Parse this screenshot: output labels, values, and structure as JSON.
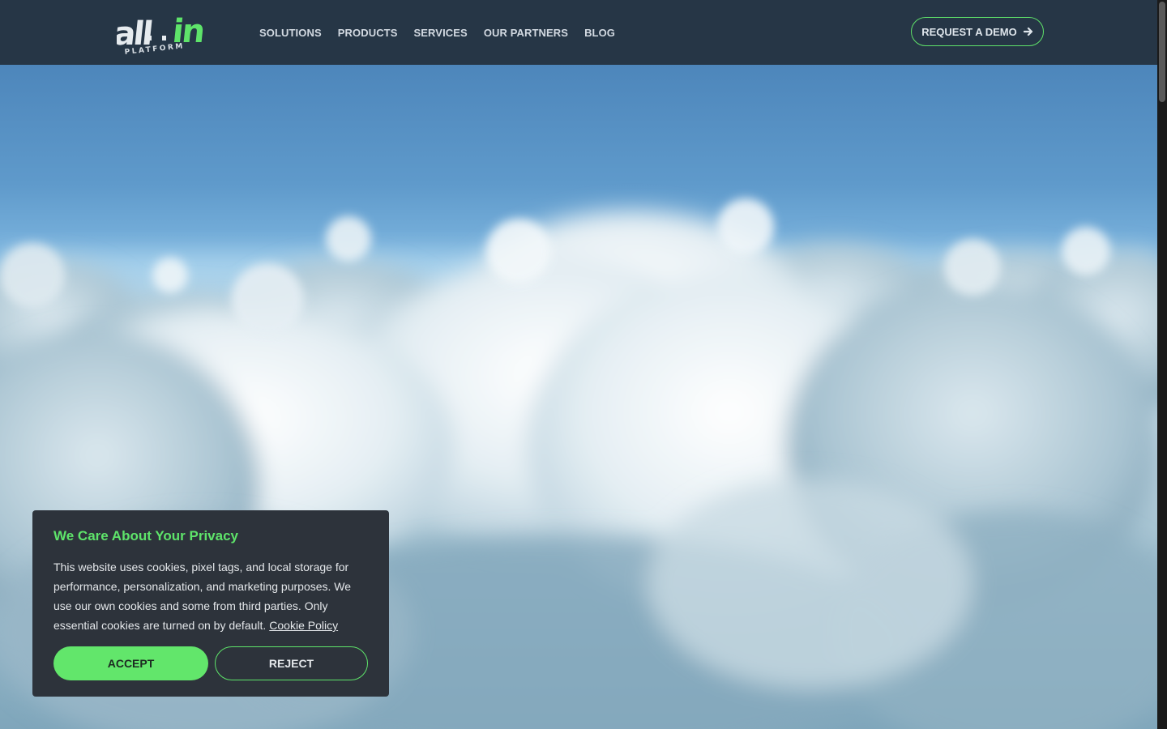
{
  "brand": {
    "logo_text_main": "all",
    "logo_text_accent": "in",
    "logo_subtext": "PLATFORM",
    "accent_color": "#5ee46a",
    "header_bg": "#263646"
  },
  "nav": {
    "items": [
      {
        "label": "SOLUTIONS"
      },
      {
        "label": "PRODUCTS"
      },
      {
        "label": "SERVICES"
      },
      {
        "label": "OUR PARTNERS"
      },
      {
        "label": "BLOG"
      }
    ],
    "cta_label": "REQUEST A DEMO",
    "cta_icon": "arrow-right-icon"
  },
  "hero": {
    "background": "clouds-sky-image"
  },
  "cookie_banner": {
    "title": "We Care About Your Privacy",
    "text": "This website uses cookies, pixel tags, and local storage for performance, personalization, and marketing purposes. We use our own cookies and some from third parties. Only essential cookies are turned on by default.",
    "link_label": "Cookie Policy",
    "accept_label": "ACCEPT",
    "reject_label": "REJECT"
  }
}
